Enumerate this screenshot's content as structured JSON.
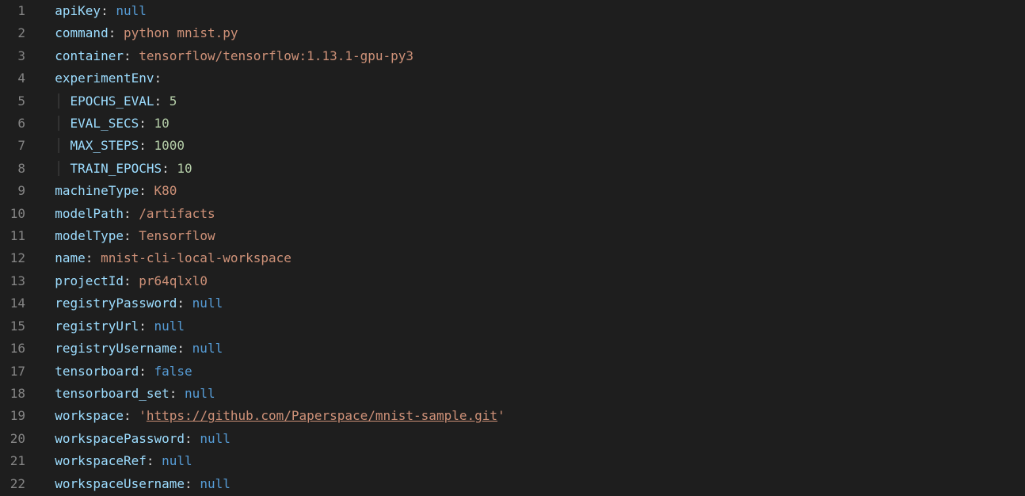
{
  "lines": [
    {
      "num": "1",
      "indent": 0,
      "guide": false,
      "key": "apiKey",
      "valueType": "null",
      "value": "null"
    },
    {
      "num": "2",
      "indent": 0,
      "guide": false,
      "key": "command",
      "valueType": "str",
      "value": "python mnist.py"
    },
    {
      "num": "3",
      "indent": 0,
      "guide": false,
      "key": "container",
      "valueType": "str",
      "value": "tensorflow/tensorflow:1.13.1-gpu-py3"
    },
    {
      "num": "4",
      "indent": 0,
      "guide": false,
      "key": "experimentEnv",
      "valueType": "none",
      "value": ""
    },
    {
      "num": "5",
      "indent": 1,
      "guide": true,
      "key": "EPOCHS_EVAL",
      "valueType": "num",
      "value": "5"
    },
    {
      "num": "6",
      "indent": 1,
      "guide": true,
      "key": "EVAL_SECS",
      "valueType": "num",
      "value": "10"
    },
    {
      "num": "7",
      "indent": 1,
      "guide": true,
      "key": "MAX_STEPS",
      "valueType": "num",
      "value": "1000"
    },
    {
      "num": "8",
      "indent": 1,
      "guide": true,
      "key": "TRAIN_EPOCHS",
      "valueType": "num",
      "value": "10"
    },
    {
      "num": "9",
      "indent": 0,
      "guide": false,
      "key": "machineType",
      "valueType": "str",
      "value": "K80"
    },
    {
      "num": "10",
      "indent": 0,
      "guide": false,
      "key": "modelPath",
      "valueType": "str",
      "value": "/artifacts"
    },
    {
      "num": "11",
      "indent": 0,
      "guide": false,
      "key": "modelType",
      "valueType": "str",
      "value": "Tensorflow"
    },
    {
      "num": "12",
      "indent": 0,
      "guide": false,
      "key": "name",
      "valueType": "str",
      "value": "mnist-cli-local-workspace"
    },
    {
      "num": "13",
      "indent": 0,
      "guide": false,
      "key": "projectId",
      "valueType": "str",
      "value": "pr64qlxl0"
    },
    {
      "num": "14",
      "indent": 0,
      "guide": false,
      "key": "registryPassword",
      "valueType": "null",
      "value": "null"
    },
    {
      "num": "15",
      "indent": 0,
      "guide": false,
      "key": "registryUrl",
      "valueType": "null",
      "value": "null"
    },
    {
      "num": "16",
      "indent": 0,
      "guide": false,
      "key": "registryUsername",
      "valueType": "null",
      "value": "null"
    },
    {
      "num": "17",
      "indent": 0,
      "guide": false,
      "key": "tensorboard",
      "valueType": "bool",
      "value": "false"
    },
    {
      "num": "18",
      "indent": 0,
      "guide": false,
      "key": "tensorboard_set",
      "valueType": "null",
      "value": "null"
    },
    {
      "num": "19",
      "indent": 0,
      "guide": false,
      "key": "workspace",
      "valueType": "link",
      "value": "https://github.com/Paperspace/mnist-sample.git"
    },
    {
      "num": "20",
      "indent": 0,
      "guide": false,
      "key": "workspacePassword",
      "valueType": "null",
      "value": "null"
    },
    {
      "num": "21",
      "indent": 0,
      "guide": false,
      "key": "workspaceRef",
      "valueType": "null",
      "value": "null"
    },
    {
      "num": "22",
      "indent": 0,
      "guide": false,
      "key": "workspaceUsername",
      "valueType": "null",
      "value": "null"
    }
  ]
}
